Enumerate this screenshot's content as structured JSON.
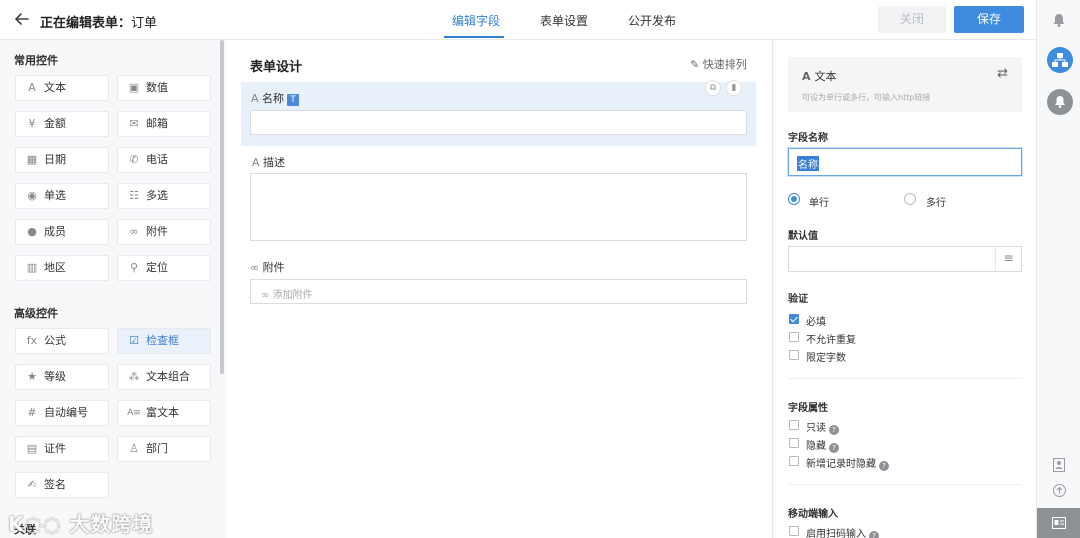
{
  "header": {
    "title_prefix": "正在编辑表单：",
    "title_name": "订单",
    "tabs": [
      "编辑字段",
      "表单设置",
      "公开发布"
    ],
    "close_label": "关闭",
    "save_label": "保存"
  },
  "left": {
    "common_title": "常用控件",
    "advanced_title": "高级控件",
    "bottom_section": "关联",
    "common": [
      {
        "label": "文本",
        "icon": "A"
      },
      {
        "label": "数值",
        "icon": "▣"
      },
      {
        "label": "金额",
        "icon": "¥"
      },
      {
        "label": "邮箱",
        "icon": "✉"
      },
      {
        "label": "日期",
        "icon": "▦"
      },
      {
        "label": "电话",
        "icon": "✆"
      },
      {
        "label": "单选",
        "icon": "◉"
      },
      {
        "label": "多选",
        "icon": "☷"
      },
      {
        "label": "成员",
        "icon": "●"
      },
      {
        "label": "附件",
        "icon": "∞"
      },
      {
        "label": "地区",
        "icon": "▥"
      },
      {
        "label": "定位",
        "icon": "⚲"
      }
    ],
    "advanced": [
      {
        "label": "公式",
        "icon": "fx"
      },
      {
        "label": "检查框",
        "icon": "☑"
      },
      {
        "label": "等级",
        "icon": "★"
      },
      {
        "label": "文本组合",
        "icon": "⁂"
      },
      {
        "label": "自动编号",
        "icon": "#"
      },
      {
        "label": "富文本",
        "icon": "A≡"
      },
      {
        "label": "证件",
        "icon": "▤"
      },
      {
        "label": "部门",
        "icon": "♙"
      },
      {
        "label": "签名",
        "icon": "✍"
      }
    ],
    "watermark": "大数跨境"
  },
  "center": {
    "title": "表单设计",
    "quick_sort": "快速排列",
    "fields": [
      {
        "label": "名称",
        "icon": "A",
        "badge": "T"
      },
      {
        "label": "描述",
        "icon": "A"
      },
      {
        "label": "附件",
        "icon": "∞",
        "placeholder": "添加附件"
      }
    ]
  },
  "props": {
    "type_icon": "A",
    "type_name": "文本",
    "type_desc": "可设为单行或多行，可输入http链接",
    "field_name_label": "字段名称",
    "field_name_value": "名称",
    "single_line": "单行",
    "multi_line": "多行",
    "default_label": "默认值",
    "validation_label": "验证",
    "validation": [
      {
        "label": "必填",
        "checked": true
      },
      {
        "label": "不允许重复",
        "checked": false
      },
      {
        "label": "限定字数",
        "checked": false
      }
    ],
    "attr_label": "字段属性",
    "attrs": [
      {
        "label": "只读",
        "help": true
      },
      {
        "label": "隐藏",
        "help": true
      },
      {
        "label": "新增记录时隐藏",
        "help": true
      }
    ],
    "mobile_label": "移动端输入",
    "mobile": [
      {
        "label": "启用扫码输入",
        "help": true
      }
    ]
  },
  "colors": {
    "accent": "#3f8be0",
    "selected_bg": "#e8f0fa"
  }
}
